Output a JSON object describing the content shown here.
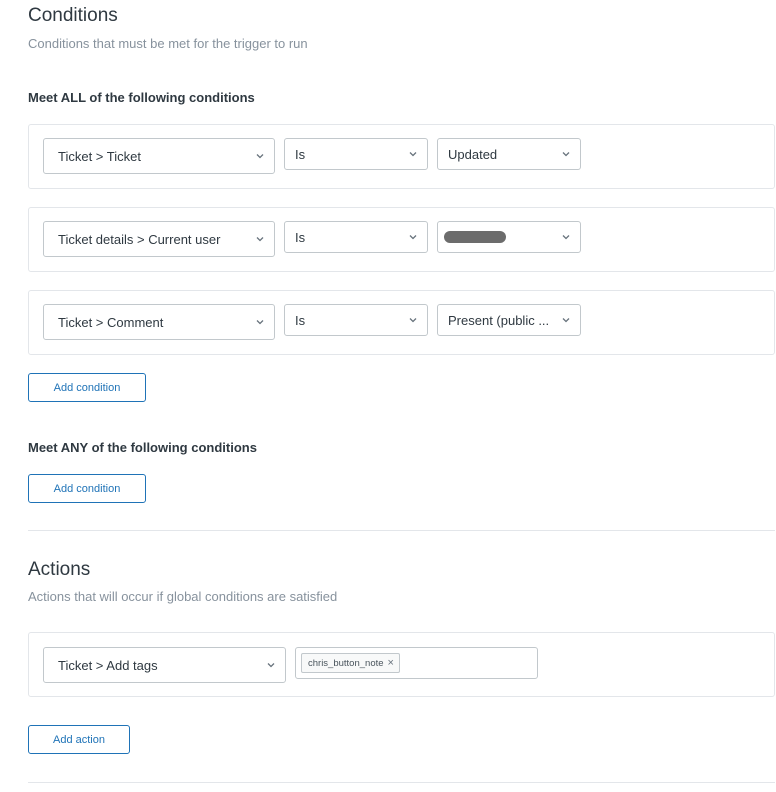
{
  "conditions": {
    "title": "Conditions",
    "subtitle": "Conditions that must be met for the trigger to run",
    "all_heading": "Meet ALL of the following conditions",
    "any_heading": "Meet ANY of the following conditions",
    "all_rows": [
      {
        "field": "Ticket > Ticket",
        "operator": "Is",
        "value": "Updated",
        "redacted": false
      },
      {
        "field": "Ticket details > Current user",
        "operator": "Is",
        "value": "",
        "redacted": true
      },
      {
        "field": "Ticket > Comment",
        "operator": "Is",
        "value": "Present (public ...",
        "redacted": false
      }
    ],
    "add_condition_label": "Add condition"
  },
  "actions": {
    "title": "Actions",
    "subtitle": "Actions that will occur if global conditions are satisfied",
    "rows": [
      {
        "field": "Ticket > Add tags",
        "tags": [
          "chris_button_note"
        ]
      }
    ],
    "tag_remove_glyph": "×",
    "add_action_label": "Add action"
  },
  "icons": {
    "dropdown": "chevron-down-icon",
    "tag_remove": "close-icon",
    "redaction": "redaction-bar"
  },
  "colors": {
    "accent": "#1f73b7",
    "border": "#c2c8cc",
    "muted_text": "#87929d",
    "text": "#2f3941",
    "redaction": "#6c6c6c"
  }
}
